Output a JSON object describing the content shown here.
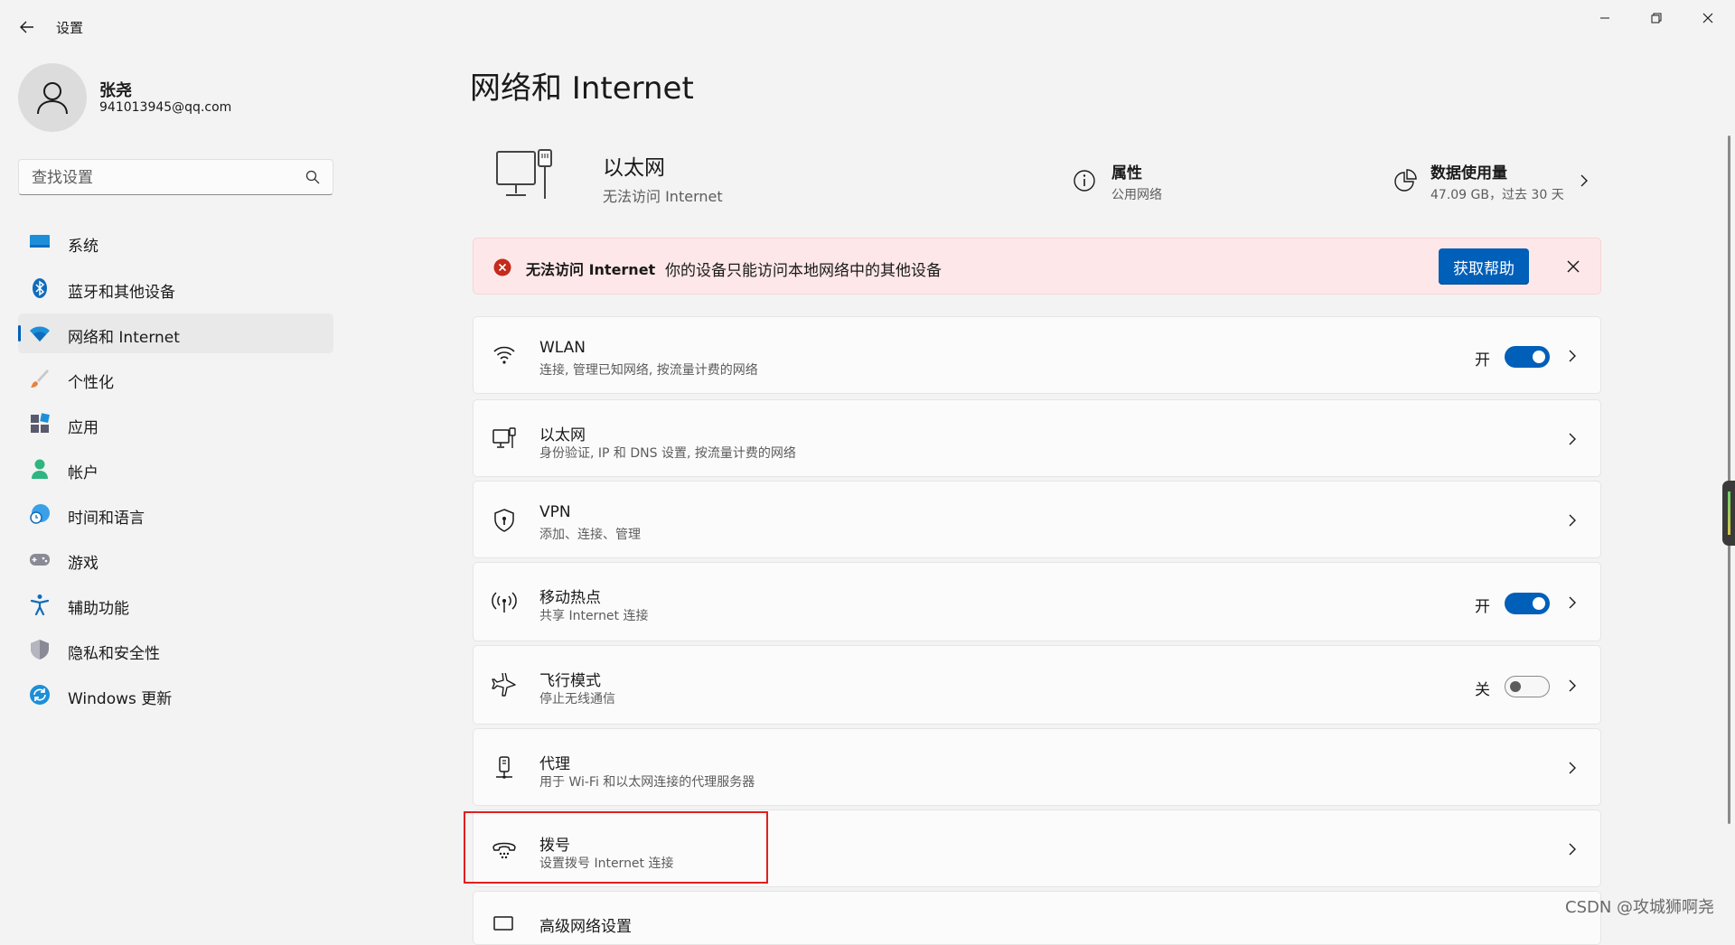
{
  "app": {
    "title": "设置"
  },
  "user": {
    "name": "张尧",
    "email": "941013945@qq.com"
  },
  "search": {
    "placeholder": "查找设置"
  },
  "sidebar": {
    "items": [
      {
        "label": "系统",
        "icon": "system-icon"
      },
      {
        "label": "蓝牙和其他设备",
        "icon": "bluetooth-icon"
      },
      {
        "label": "网络和 Internet",
        "icon": "network-icon",
        "active": true
      },
      {
        "label": "个性化",
        "icon": "brush-icon"
      },
      {
        "label": "应用",
        "icon": "apps-icon"
      },
      {
        "label": "帐户",
        "icon": "account-icon"
      },
      {
        "label": "时间和语言",
        "icon": "clock-globe-icon"
      },
      {
        "label": "游戏",
        "icon": "gamepad-icon"
      },
      {
        "label": "辅助功能",
        "icon": "accessibility-icon"
      },
      {
        "label": "隐私和安全性",
        "icon": "shield-icon"
      },
      {
        "label": "Windows 更新",
        "icon": "update-icon"
      }
    ]
  },
  "main": {
    "title": "网络和 Internet",
    "header": {
      "connection_name": "以太网",
      "connection_status": "无法访问 Internet",
      "properties_title": "属性",
      "properties_sub": "公用网络",
      "data_title": "数据使用量",
      "data_sub": "47.09 GB，过去 30 天"
    },
    "banner": {
      "title": "无法访问 Internet",
      "message": "你的设备只能访问本地网络中的其他设备",
      "button": "获取帮助"
    },
    "rows": [
      {
        "title": "WLAN",
        "sub": "连接, 管理已知网络, 按流量计费的网络",
        "toggle_label": "开",
        "toggle_on": true,
        "icon": "wifi-icon"
      },
      {
        "title": "以太网",
        "sub": "身份验证, IP 和 DNS 设置, 按流量计费的网络",
        "icon": "ethernet-icon"
      },
      {
        "title": "VPN",
        "sub": "添加、连接、管理",
        "icon": "vpn-shield-icon"
      },
      {
        "title": "移动热点",
        "sub": "共享 Internet 连接",
        "toggle_label": "开",
        "toggle_on": true,
        "icon": "hotspot-icon"
      },
      {
        "title": "飞行模式",
        "sub": "停止无线通信",
        "toggle_label": "关",
        "toggle_on": false,
        "icon": "airplane-icon"
      },
      {
        "title": "代理",
        "sub": "用于 Wi-Fi 和以太网连接的代理服务器",
        "icon": "proxy-icon"
      },
      {
        "title": "拨号",
        "sub": "设置拨号 Internet 连接",
        "icon": "dialup-icon"
      },
      {
        "title": "高级网络设置",
        "icon": "advanced-network-icon"
      }
    ]
  },
  "watermark": "CSDN @攻城狮啊尧",
  "colors": {
    "accent": "#005fb8",
    "error": "#c42b1c",
    "banner_bg": "#fde7e9",
    "highlight": "#e02020"
  }
}
